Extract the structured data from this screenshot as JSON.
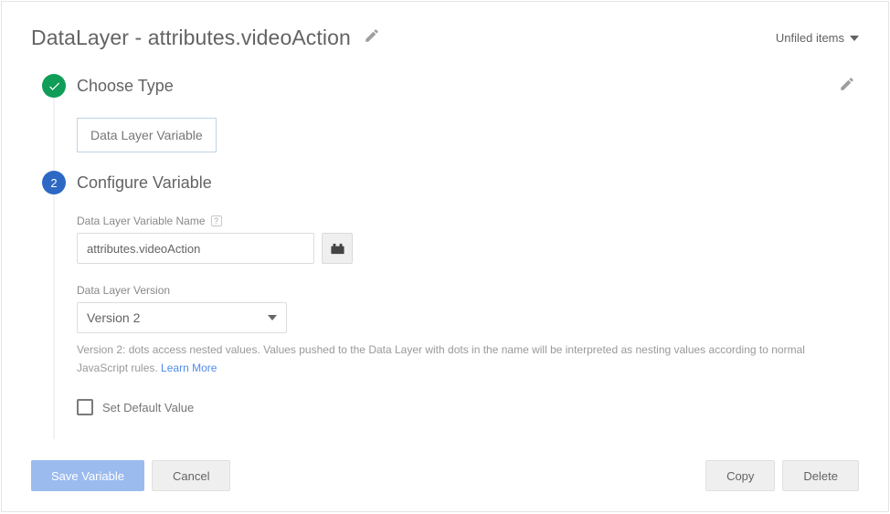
{
  "title": "DataLayer - attributes.videoAction",
  "folder_menu_label": "Unfiled items",
  "step1": {
    "title": "Choose Type",
    "type_chip": "Data Layer Variable"
  },
  "step2": {
    "number": "2",
    "title": "Configure Variable",
    "var_name_label": "Data Layer Variable Name",
    "var_name_value": "attributes.videoAction",
    "version_label": "Data Layer Version",
    "version_value": "Version 2",
    "help_text_pre": "Version 2: dots access nested values. Values pushed to the Data Layer with dots in the name will be interpreted as nesting values according to normal JavaScript rules. ",
    "learn_more": "Learn More",
    "set_default_label": "Set Default Value"
  },
  "buttons": {
    "save": "Save Variable",
    "cancel": "Cancel",
    "copy": "Copy",
    "delete": "Delete"
  }
}
